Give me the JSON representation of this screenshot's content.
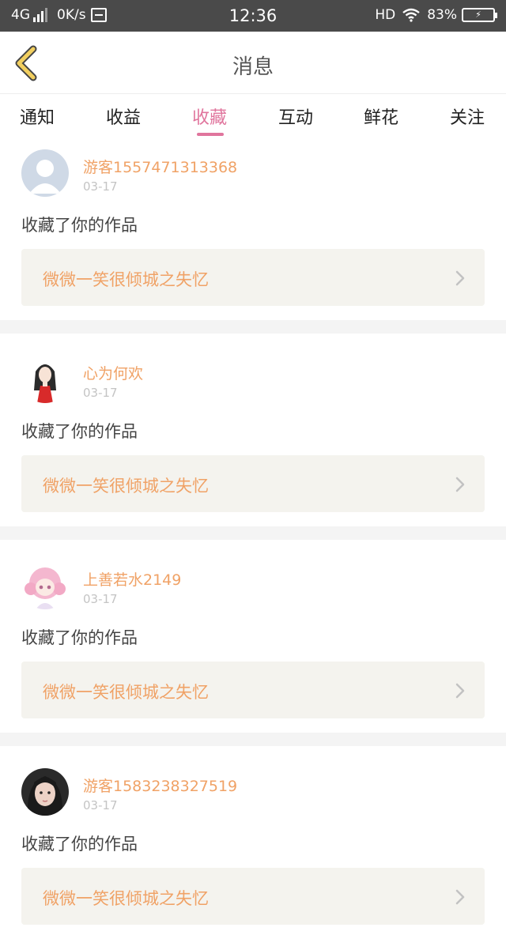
{
  "status_bar": {
    "network": "4G",
    "speed": "0K/s",
    "time": "12:36",
    "hd": "HD",
    "battery": "83%"
  },
  "header": {
    "title": "消息",
    "back_icon": "chevron-left-icon"
  },
  "tabs": [
    {
      "label": "通知"
    },
    {
      "label": "收益"
    },
    {
      "label": "收藏",
      "active": true
    },
    {
      "label": "互动"
    },
    {
      "label": "鲜花"
    },
    {
      "label": "关注"
    }
  ],
  "colors": {
    "accent": "#e0759d",
    "name": "#f0a266",
    "status_bar": "#4a4a4a",
    "back_icon": "#f2cf5f"
  },
  "messages": [
    {
      "user": "游客1557471313368",
      "date": "03-17",
      "action": "收藏了你的作品",
      "work": "微微一笑很倾城之失忆"
    },
    {
      "user": "心为何欢",
      "date": "03-17",
      "action": "收藏了你的作品",
      "work": "微微一笑很倾城之失忆"
    },
    {
      "user": "上善若水2149",
      "date": "03-17",
      "action": "收藏了你的作品",
      "work": "微微一笑很倾城之失忆"
    },
    {
      "user": "游客1583238327519",
      "date": "03-17",
      "action": "收藏了你的作品",
      "work": "微微一笑很倾城之失忆"
    }
  ]
}
